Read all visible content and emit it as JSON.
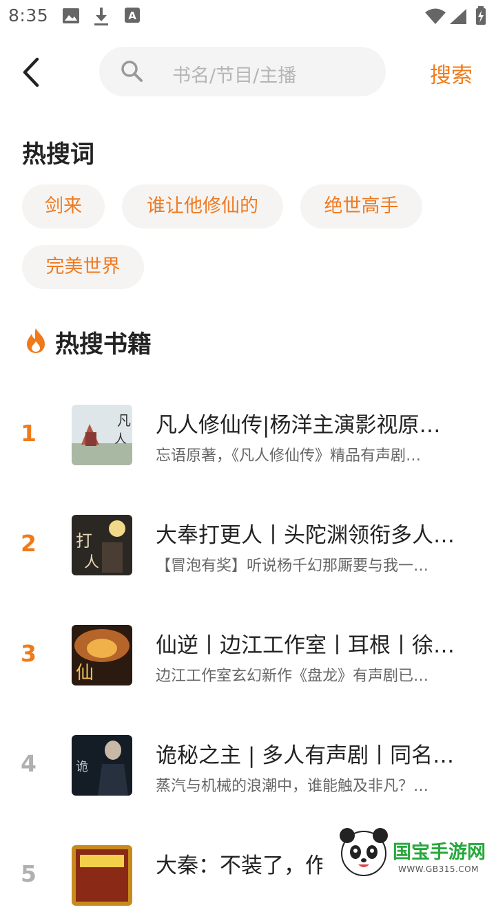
{
  "status_bar": {
    "time": "8:35"
  },
  "search": {
    "placeholder": "书名/节目/主播",
    "button_label": "搜索"
  },
  "hot_words": {
    "title": "热搜词",
    "items": [
      "剑来",
      "谁让他修仙的",
      "绝世高手",
      "完美世界"
    ]
  },
  "hot_books": {
    "title": "热搜书籍",
    "items": [
      {
        "rank": "1",
        "title": "凡人修仙传|杨洋主演影视原…",
        "desc": "忘语原著，《凡人修仙传》精品有声剧…"
      },
      {
        "rank": "2",
        "title": "大奉打更人丨头陀渊领衔多人…",
        "desc": "【冒泡有奖】听说杨千幻那厮要与我一…"
      },
      {
        "rank": "3",
        "title": "仙逆丨边江工作室丨耳根丨徐…",
        "desc": "边江工作室玄幻新作《盘龙》有声剧已…"
      },
      {
        "rank": "4",
        "title": "诡秘之主 | 多人有声剧丨同名…",
        "desc": "蒸汽与机械的浪潮中，谁能触及非凡？…"
      },
      {
        "rank": "5",
        "title": "大秦：不装了，作",
        "desc": ""
      }
    ]
  },
  "watermark": {
    "text": "国宝手游网",
    "url": "WWW.GB315.COM"
  },
  "colors": {
    "accent": "#f07a1a",
    "chip_bg": "#f6f4f2",
    "search_bg": "#f4f4f4"
  }
}
